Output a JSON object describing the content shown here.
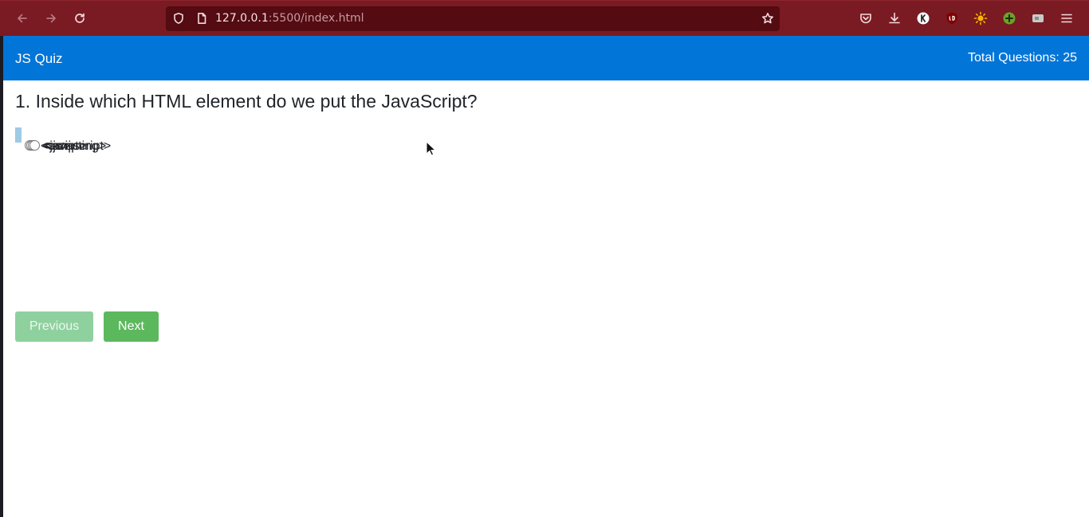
{
  "browser": {
    "url_host": "127.0.0.1",
    "url_rest": ":5500/index.html",
    "colors": {
      "toolbar": "#7a1a22",
      "urlbar": "#540b12"
    }
  },
  "navbar": {
    "brand": "JS Quiz",
    "total_questions": "Total Questions: 25",
    "color": "#0275d8"
  },
  "quiz": {
    "question": "1. Inside which HTML element do we put the JavaScript?",
    "options": [
      {
        "label": "<script>"
      },
      {
        "label": "<javascript>"
      },
      {
        "label": "<scripting>"
      },
      {
        "label": "<js>"
      }
    ],
    "previous_label": "Previous",
    "next_label": "Next"
  }
}
